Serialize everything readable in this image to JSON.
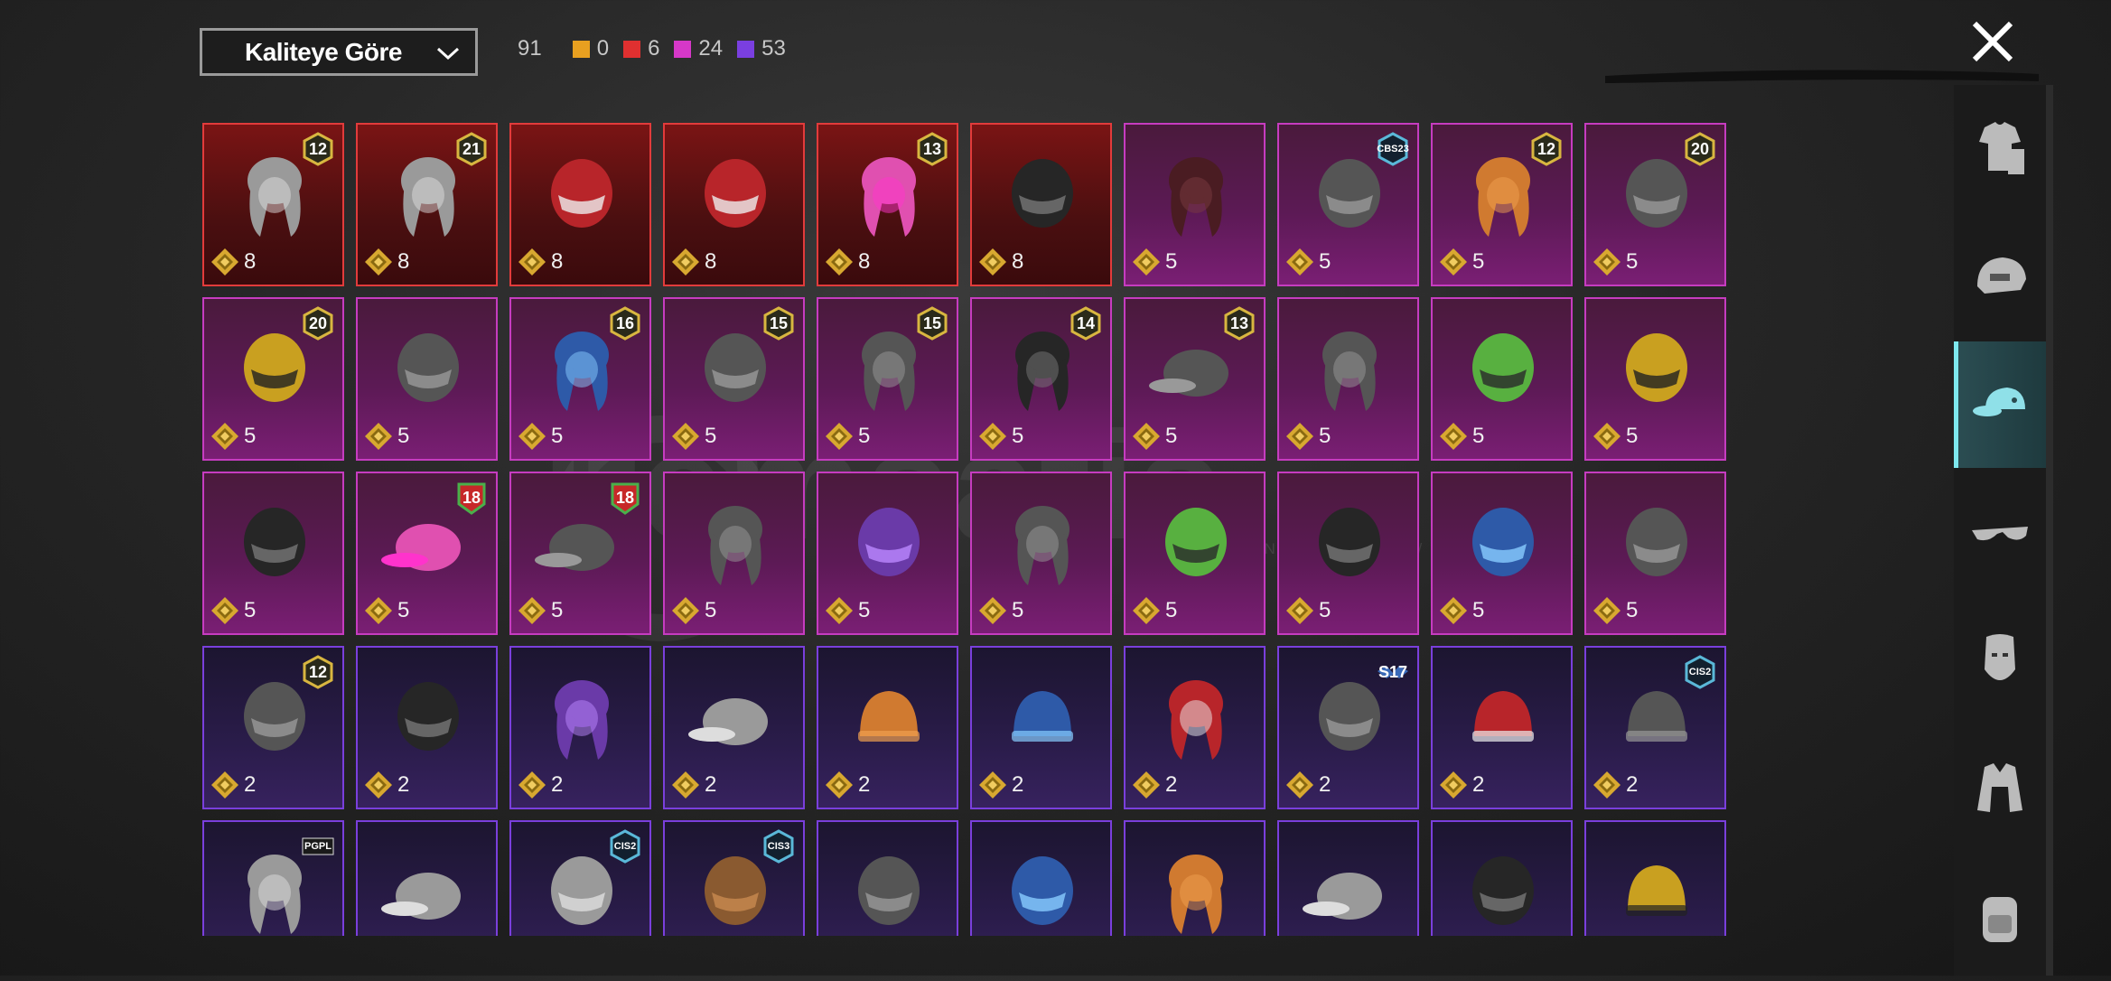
{
  "sort_dropdown": {
    "label": "Kaliteye Göre"
  },
  "counts": {
    "total": "91",
    "items": [
      {
        "color": "#e8a020",
        "value": "0"
      },
      {
        "color": "#e03030",
        "value": "6"
      },
      {
        "color": "#d638c8",
        "value": "24"
      },
      {
        "color": "#7a3fe0",
        "value": "53"
      }
    ]
  },
  "watermark": {
    "text": "itemsatis",
    "subtext": "SHOP / SKIN / FREE / E-PIN / HESAP"
  },
  "items": [
    {
      "quality": "red",
      "art": "gray-wavy-hair-icon",
      "badge": "12",
      "badge_type": "gold",
      "price": "8"
    },
    {
      "quality": "red",
      "art": "white-hair-mask-icon",
      "badge": "21",
      "badge_type": "gold",
      "price": "8"
    },
    {
      "quality": "red",
      "art": "red-horned-mask-icon",
      "badge": "",
      "badge_type": "",
      "price": "8"
    },
    {
      "quality": "red",
      "art": "red-helmet-icon",
      "badge": "",
      "badge_type": "",
      "price": "8"
    },
    {
      "quality": "red",
      "art": "pink-dreads-mask-icon",
      "badge": "13",
      "badge_type": "gold",
      "price": "8"
    },
    {
      "quality": "red",
      "art": "dark-horned-helmet-icon",
      "badge": "",
      "badge_type": "",
      "price": "8"
    },
    {
      "quality": "pink",
      "art": "maroon-hair-icon",
      "badge": "",
      "badge_type": "",
      "price": "5"
    },
    {
      "quality": "pink",
      "art": "cat-ear-headset-icon",
      "badge": "CBS23",
      "badge_type": "teal",
      "price": "5"
    },
    {
      "quality": "pink",
      "art": "orange-ponytail-icon",
      "badge": "12",
      "badge_type": "gold",
      "price": "5"
    },
    {
      "quality": "pink",
      "art": "bunny-hat-blonde-icon",
      "badge": "20",
      "badge_type": "gold",
      "price": "5"
    },
    {
      "quality": "pink",
      "art": "gold-skull-helmet-icon",
      "badge": "20",
      "badge_type": "gold",
      "price": "5"
    },
    {
      "quality": "pink",
      "art": "wrestler-mask-icon",
      "badge": "",
      "badge_type": "",
      "price": "5"
    },
    {
      "quality": "pink",
      "art": "peacock-hair-icon",
      "badge": "16",
      "badge_type": "gold",
      "price": "5"
    },
    {
      "quality": "pink",
      "art": "bird-mask-icon",
      "badge": "15",
      "badge_type": "gold",
      "price": "5"
    },
    {
      "quality": "pink",
      "art": "spiked-hair-icon",
      "badge": "15",
      "badge_type": "gold",
      "price": "5"
    },
    {
      "quality": "pink",
      "art": "black-hair-headband-icon",
      "badge": "14",
      "badge_type": "gold",
      "price": "5"
    },
    {
      "quality": "pink",
      "art": "devil-horn-cap-icon",
      "badge": "13",
      "badge_type": "gold",
      "price": "5"
    },
    {
      "quality": "pink",
      "art": "crowned-hair-icon",
      "badge": "",
      "badge_type": "",
      "price": "5"
    },
    {
      "quality": "pink",
      "art": "green-mask-icon",
      "badge": "",
      "badge_type": "",
      "price": "5"
    },
    {
      "quality": "pink",
      "art": "gold-pirate-helmet-icon",
      "badge": "",
      "badge_type": "",
      "price": "5"
    },
    {
      "quality": "pink",
      "art": "kendo-helmet-icon",
      "badge": "",
      "badge_type": "",
      "price": "5"
    },
    {
      "quality": "pink",
      "art": "pink-spiked-cap-icon",
      "badge": "18",
      "badge_type": "green",
      "price": "5"
    },
    {
      "quality": "pink",
      "art": "headphone-cap-icon",
      "badge": "18",
      "badge_type": "green",
      "price": "5"
    },
    {
      "quality": "pink",
      "art": "dreadlocks-icon",
      "badge": "",
      "badge_type": "",
      "price": "5"
    },
    {
      "quality": "pink",
      "art": "purple-mohawk-mask-icon",
      "badge": "",
      "badge_type": "",
      "price": "5"
    },
    {
      "quality": "pink",
      "art": "feather-hair-icon",
      "badge": "",
      "badge_type": "",
      "price": "5"
    },
    {
      "quality": "pink",
      "art": "frog-helmet-icon",
      "badge": "",
      "badge_type": "",
      "price": "5"
    },
    {
      "quality": "pink",
      "art": "cyber-helmet-icon",
      "badge": "",
      "badge_type": "",
      "price": "5"
    },
    {
      "quality": "pink",
      "art": "blue-feather-mask-icon",
      "badge": "",
      "badge_type": "",
      "price": "5"
    },
    {
      "quality": "pink",
      "art": "horns-headband-icon",
      "badge": "",
      "badge_type": "",
      "price": "5"
    },
    {
      "quality": "purple",
      "art": "bunny-ear-helmet-icon",
      "badge": "12",
      "badge_type": "gold",
      "price": "2"
    },
    {
      "quality": "purple",
      "art": "visor-helmet-icon",
      "badge": "",
      "badge_type": "",
      "price": "2"
    },
    {
      "quality": "purple",
      "art": "purple-hair-mask-icon",
      "badge": "",
      "badge_type": "",
      "price": "2"
    },
    {
      "quality": "purple",
      "art": "red-white-cap-icon",
      "badge": "",
      "badge_type": "",
      "price": "2"
    },
    {
      "quality": "purple",
      "art": "orange-beanie-icon",
      "badge": "",
      "badge_type": "",
      "price": "2"
    },
    {
      "quality": "purple",
      "art": "navy-beanie-icon",
      "badge": "",
      "badge_type": "",
      "price": "2"
    },
    {
      "quality": "purple",
      "art": "bucket-hat-red-hair-icon",
      "badge": "",
      "badge_type": "",
      "price": "2"
    },
    {
      "quality": "purple",
      "art": "winged-helmet-icon",
      "badge": "S17",
      "badge_type": "wings",
      "price": "2"
    },
    {
      "quality": "purple",
      "art": "red-fez-icon",
      "badge": "",
      "badge_type": "",
      "price": "2"
    },
    {
      "quality": "purple",
      "art": "striped-beanie-icon",
      "badge": "CIS2",
      "badge_type": "teal",
      "price": "2"
    },
    {
      "quality": "purple",
      "art": "gray-hair-icon",
      "badge": "PGPL",
      "badge_type": "logo",
      "price": ""
    },
    {
      "quality": "purple",
      "art": "gray-cap-headset-icon",
      "badge": "",
      "badge_type": "",
      "price": ""
    },
    {
      "quality": "purple",
      "art": "chef-hat-mask-icon",
      "badge": "CIS2",
      "badge_type": "teal",
      "price": ""
    },
    {
      "quality": "purple",
      "art": "brown-animal-hat-icon",
      "badge": "CIS3",
      "badge_type": "teal",
      "price": ""
    },
    {
      "quality": "purple",
      "art": "football-helmet-icon",
      "badge": "",
      "badge_type": "",
      "price": ""
    },
    {
      "quality": "purple",
      "art": "cricket-helmet-icon",
      "badge": "",
      "badge_type": "",
      "price": ""
    },
    {
      "quality": "purple",
      "art": "orange-hair-mask-icon",
      "badge": "",
      "badge_type": "",
      "price": ""
    },
    {
      "quality": "purple",
      "art": "gray-cap-icon",
      "badge": "",
      "badge_type": "",
      "price": ""
    },
    {
      "quality": "purple",
      "art": "gas-mask-icon",
      "badge": "",
      "badge_type": "",
      "price": ""
    },
    {
      "quality": "purple",
      "art": "mustard-beanie-icon",
      "badge": "",
      "badge_type": "",
      "price": ""
    }
  ],
  "sidebar": [
    {
      "name": "outfit-icon",
      "active": false
    },
    {
      "name": "helmet-icon",
      "active": false
    },
    {
      "name": "cap-icon",
      "active": true
    },
    {
      "name": "glasses-icon",
      "active": false
    },
    {
      "name": "face-mask-icon",
      "active": false
    },
    {
      "name": "jacket-icon",
      "active": false
    },
    {
      "name": "backpack-icon",
      "active": false
    }
  ]
}
